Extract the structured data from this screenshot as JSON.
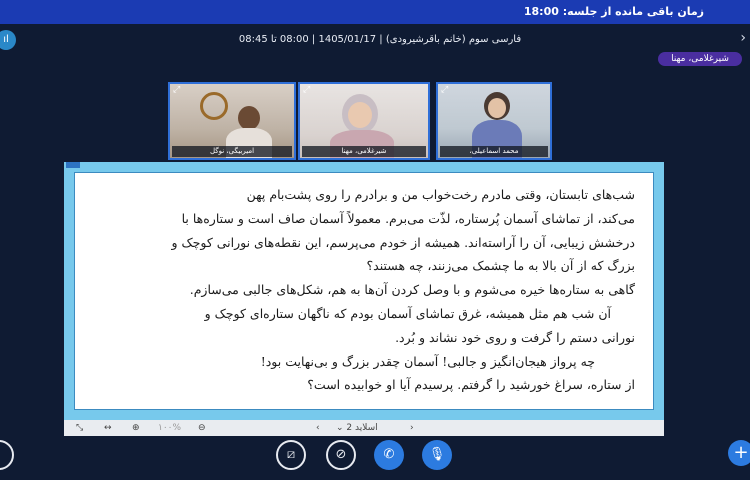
{
  "header": {
    "timer_text": "زمان باقی مانده از جلسه: 18:00",
    "meeting_title": "فارسی سوم (خانم باقرشیرودی) | 1405/01/17 | 08:00 تا 08:45"
  },
  "active_speaker": "شیرغلامی، مهنا",
  "participants": [
    {
      "name": "امیربیگی، نوگل"
    },
    {
      "name": "شیرغلامی، مهنا"
    },
    {
      "name": "محمد اسماعیلی،"
    }
  ],
  "slide": {
    "lines": [
      "شب‌های تابستان، وقتی مادرم رخت‌خواب من و برادرم را روی پشت‌بام پهن",
      "می‌کند، از تماشای آسمان پُرستاره، لذّت می‌برم. معمولاً آسمان صاف است و ستاره‌ها با",
      "درخشش زیبایی، آن را آراسته‌اند. همیشه از خودم می‌پرسم، این نقطه‌های نورانی کوچک و",
      "بزرگ که از آن بالا به ما چشمک می‌زنند، چه هستند؟",
      "گاهی به ستاره‌ها خیره می‌شوم و با وصل کردن آن‌ها به هم، شکل‌های جالبی می‌سازم.",
      "آن شب هم مثل همیشه، غرق تماشای آسمان بودم که ناگهان ستاره‌ای کوچک و",
      "نورانی دستم را گرفت و روی خود نشاند و بُرد.",
      "چه پرواز هیجان‌انگیز و جالبی! آسمان چقدر بزرگ و بی‌نهایت بود!",
      "از ستاره، سراغ خورشید را گرفتم. پرسیدم آیا او خوابیده است؟"
    ]
  },
  "slide_toolbar": {
    "zoom": "۱۰۰%",
    "slide_label": "اسلاید 2"
  },
  "colors": {
    "topbar": "#1b3bb3",
    "background": "#0f1b33",
    "slide_frame": "#77c9ec",
    "accent_button": "#2c7be0",
    "speaker_tag": "#4a2ea0"
  },
  "icons": {
    "bottom_controls": [
      "share-screen-icon",
      "camera-off-icon",
      "phone-icon",
      "microphone-icon"
    ],
    "toolbar": [
      "fullscreen-icon",
      "fit-width-icon",
      "zoom-in-icon",
      "zoom-out-icon"
    ]
  }
}
